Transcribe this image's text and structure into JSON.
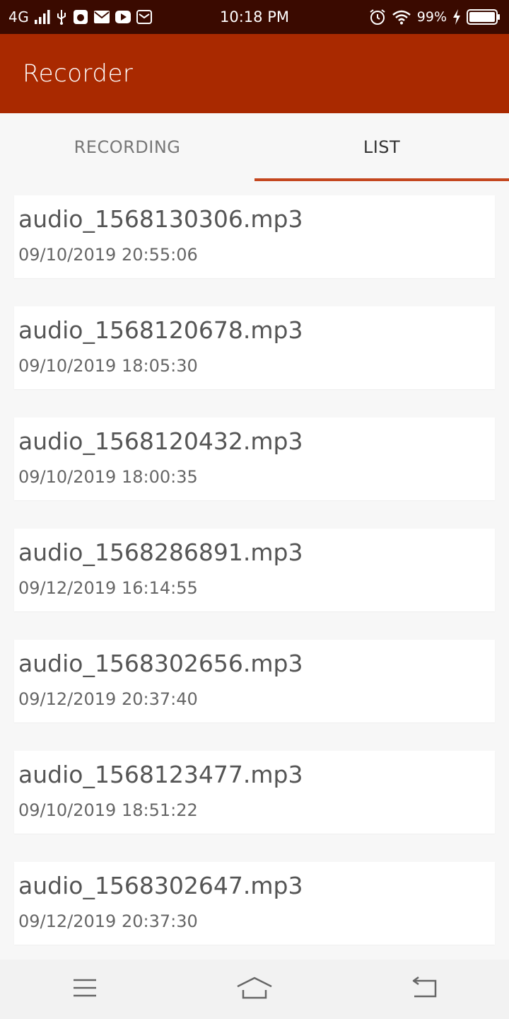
{
  "status_bar": {
    "network": "4G",
    "time": "10:18 PM",
    "battery_percent": "99%",
    "icons_left": [
      "signal-icon",
      "usb-icon",
      "debug-icon",
      "mail-icon",
      "youtube-icon",
      "message-icon"
    ],
    "icons_right": [
      "alarm-icon",
      "wifi-icon",
      "charging-icon",
      "battery-icon"
    ]
  },
  "app_bar": {
    "title": "Recorder",
    "color": "#a92900"
  },
  "tabs": [
    {
      "label": "RECORDING",
      "active": false
    },
    {
      "label": "LIST",
      "active": true
    }
  ],
  "accent_color": "#c4471f",
  "recordings": [
    {
      "name": "audio_1568130306.mp3",
      "date": "09/10/2019 20:55:06"
    },
    {
      "name": "audio_1568120678.mp3",
      "date": "09/10/2019 18:05:30"
    },
    {
      "name": "audio_1568120432.mp3",
      "date": "09/10/2019 18:00:35"
    },
    {
      "name": "audio_1568286891.mp3",
      "date": "09/12/2019 16:14:55"
    },
    {
      "name": "audio_1568302656.mp3",
      "date": "09/12/2019 20:37:40"
    },
    {
      "name": "audio_1568123477.mp3",
      "date": "09/10/2019 18:51:22"
    },
    {
      "name": "audio_1568302647.mp3",
      "date": "09/12/2019 20:37:30"
    }
  ],
  "nav_bar": {
    "icons": [
      "menu-icon",
      "home-icon",
      "back-icon"
    ]
  }
}
